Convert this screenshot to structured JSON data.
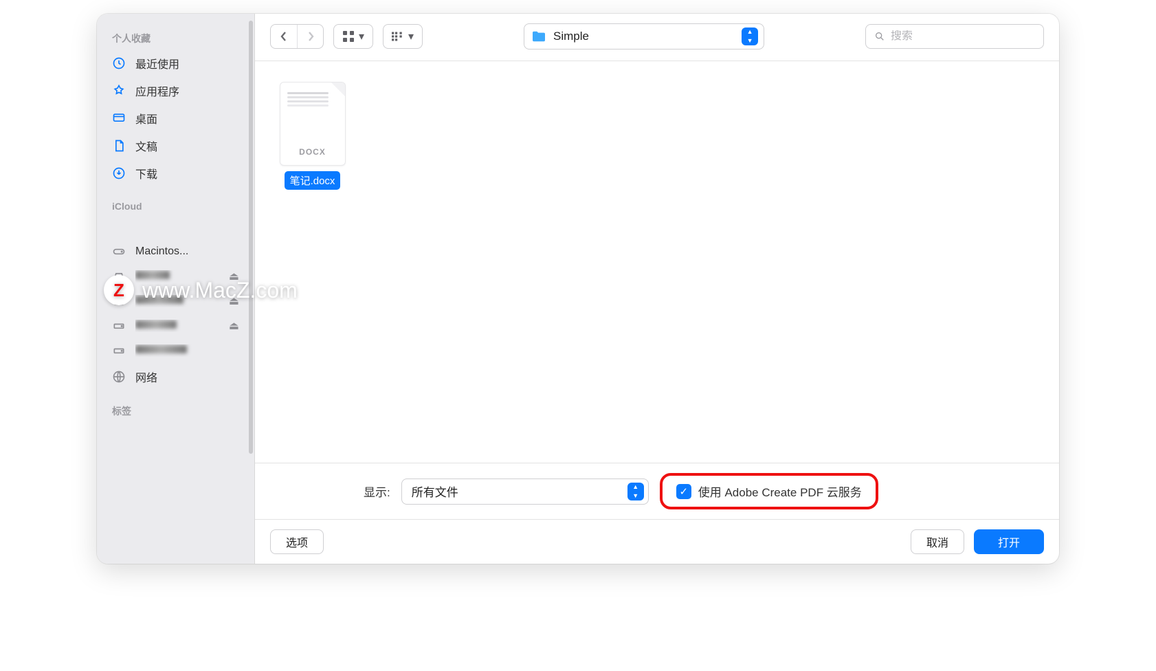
{
  "watermark": {
    "badge": "Z",
    "text": "www.MacZ.com"
  },
  "sidebar": {
    "favorites_header": "个人收藏",
    "icloud_header": "iCloud",
    "tags_header": "标签",
    "items": [
      {
        "icon": "clock",
        "label": "最近使用"
      },
      {
        "icon": "apps",
        "label": "应用程序"
      },
      {
        "icon": "desktop",
        "label": "桌面"
      },
      {
        "icon": "doc",
        "label": "文稿"
      },
      {
        "icon": "download",
        "label": "下载"
      }
    ],
    "locations": [
      {
        "icon": "hdd",
        "label": "Macintos...",
        "eject": false,
        "blurred": false
      },
      {
        "icon": "ext",
        "label": "",
        "eject": true,
        "blurred": true
      },
      {
        "icon": "ext",
        "label": "",
        "eject": true,
        "blurred": true
      },
      {
        "icon": "disk",
        "label": "",
        "eject": true,
        "blurred": true
      },
      {
        "icon": "disk",
        "label": "",
        "eject": false,
        "blurred": true
      },
      {
        "icon": "globe",
        "label": "网络",
        "eject": false,
        "blurred": false
      }
    ]
  },
  "toolbar": {
    "path_label": "Simple",
    "search_placeholder": "搜索"
  },
  "content": {
    "files": [
      {
        "type_badge": "DOCX",
        "name": "笔记.docx",
        "selected": true
      }
    ]
  },
  "options": {
    "show_label": "显示:",
    "show_value": "所有文件",
    "cloud_checkbox_label": "使用 Adobe Create PDF 云服务",
    "cloud_checked": true
  },
  "buttons": {
    "options": "选项",
    "cancel": "取消",
    "open": "打开"
  }
}
